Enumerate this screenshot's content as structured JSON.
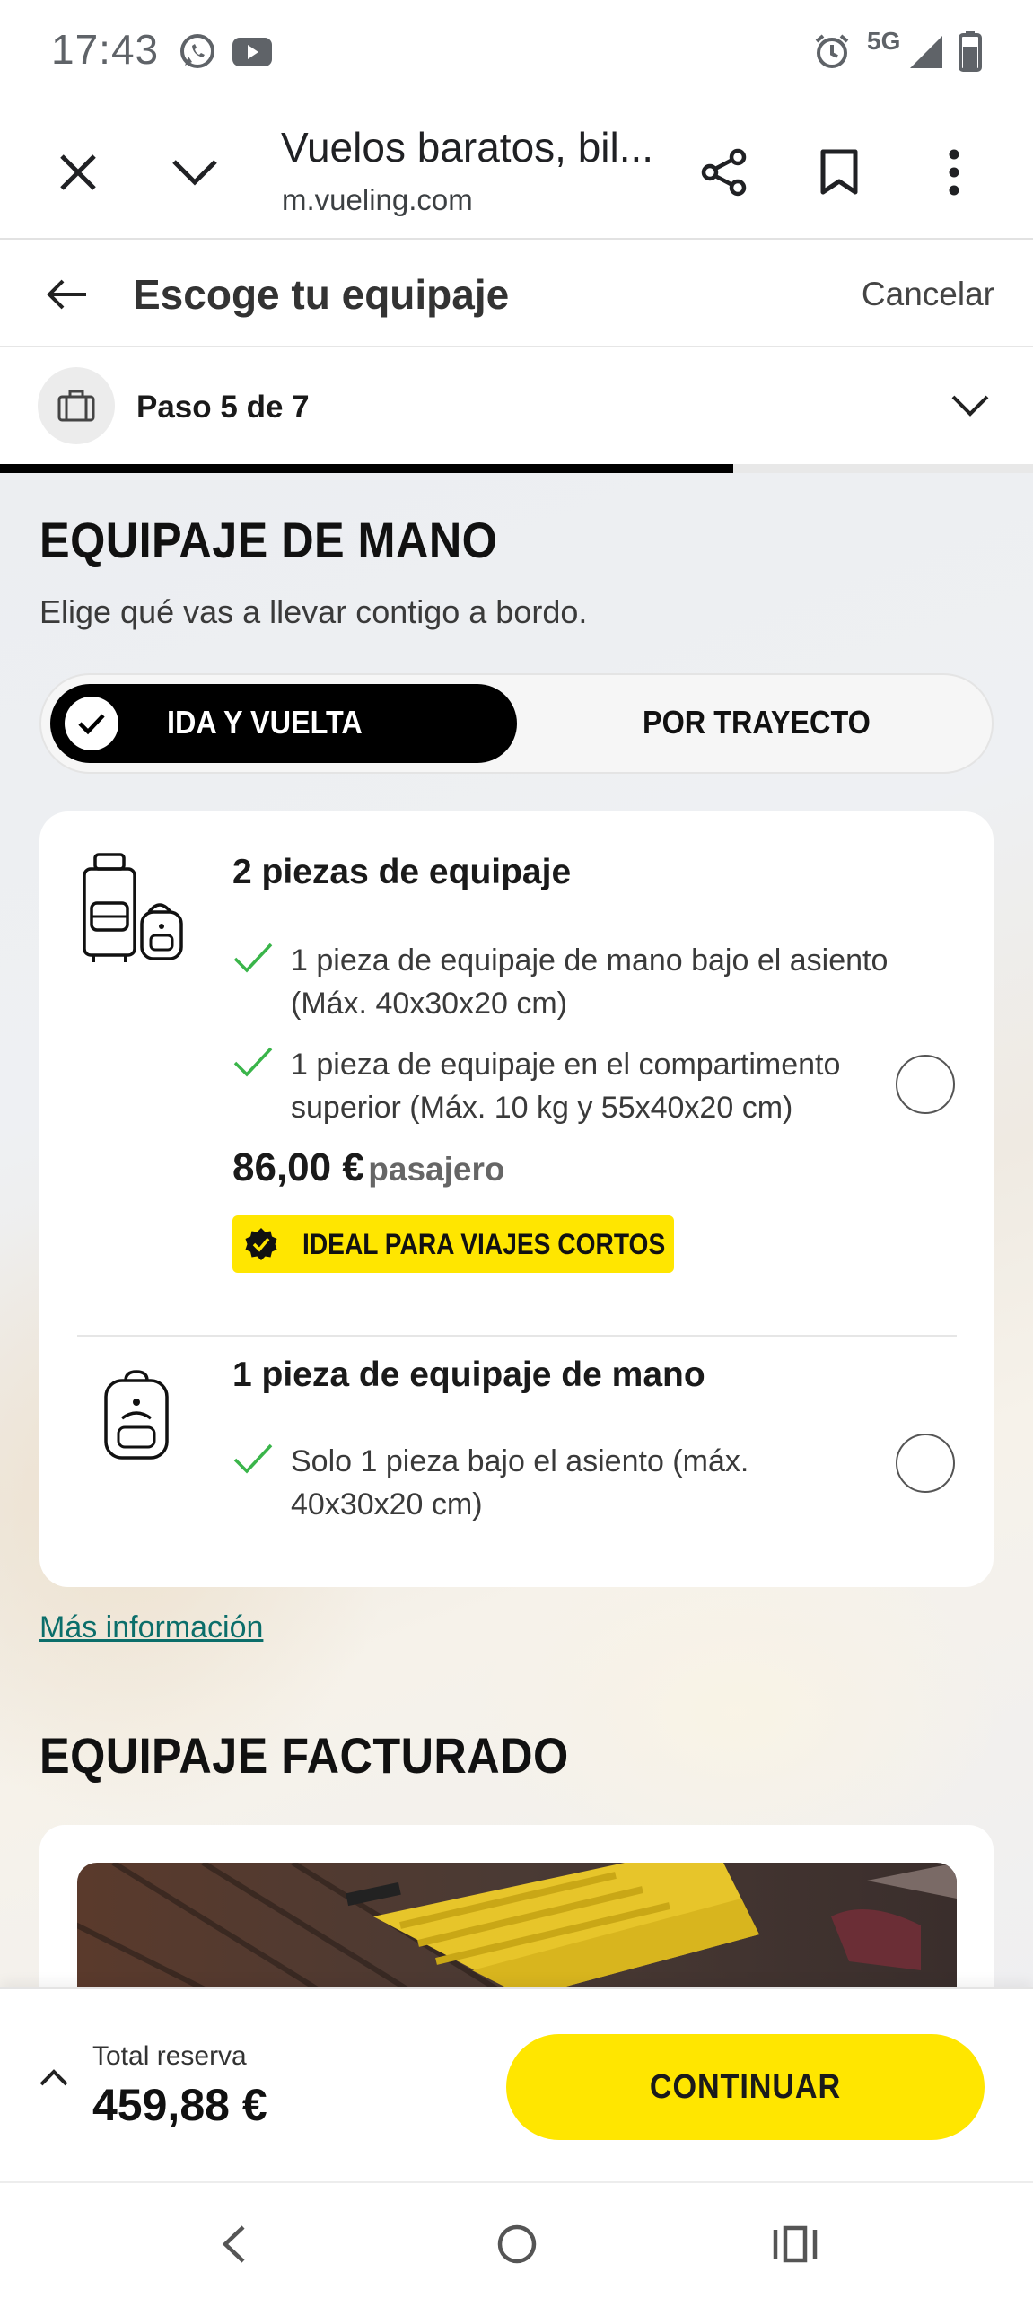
{
  "status_bar": {
    "time": "17:43",
    "network": "5G",
    "icons": [
      "whatsapp-icon",
      "youtube-icon",
      "alarm-icon",
      "signal-icon",
      "battery-icon"
    ]
  },
  "browser": {
    "page_title": "Vuelos baratos, bil...",
    "url": "m.vueling.com",
    "icons": [
      "close-icon",
      "chevron-down-icon",
      "share-icon",
      "bookmark-icon",
      "more-vert-icon"
    ]
  },
  "header": {
    "title": "Escoge tu equipaje",
    "cancel": "Cancelar"
  },
  "steps": {
    "label": "Paso 5 de 7",
    "current": 5,
    "total": 7,
    "progress": 0.71
  },
  "carry_on": {
    "title": "EQUIPAJE DE MANO",
    "subtitle": "Elige qué vas a llevar contigo a bordo.",
    "toggle": {
      "active": "IDA Y VUELTA",
      "inactive": "POR TRAYECTO"
    },
    "options": [
      {
        "title": "2 piezas de equipaje",
        "features": [
          "1 pieza de equipaje de mano bajo el asiento (Máx. 40x30x20 cm)",
          "1 pieza de equipaje en el compartimento superior (Máx. 10 kg y 55x40x20 cm)"
        ],
        "price": "86,00 €",
        "price_unit": "pasajero",
        "badge": "IDEAL PARA VIAJES CORTOS",
        "selected": false
      },
      {
        "title": "1 pieza de equipaje de mano",
        "features": [
          "Solo 1 pieza bajo el asiento (máx. 40x30x20 cm)"
        ],
        "selected": false
      }
    ],
    "more_info": "Más información"
  },
  "checked": {
    "title": "EQUIPAJE FACTURADO"
  },
  "footer": {
    "total_label": "Total reserva",
    "total_amount": "459,88 €",
    "continue": "CONTINUAR"
  },
  "colors": {
    "brand_yellow": "#ffe600",
    "check_green": "#3ab54a",
    "link_teal": "#0b6e6a"
  }
}
